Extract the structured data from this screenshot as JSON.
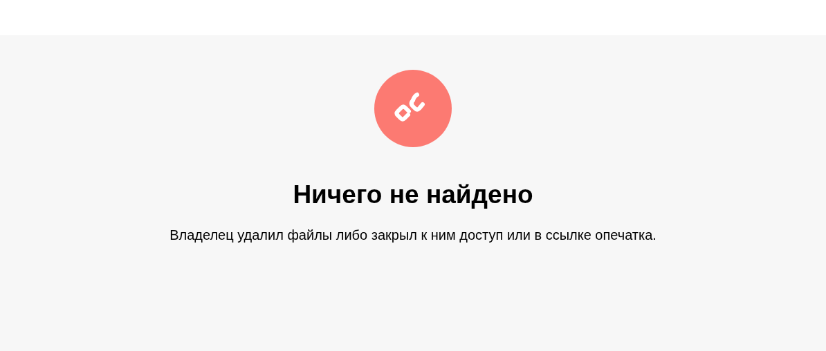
{
  "title": "Ничего не найдено",
  "message": "Владелец удалил файлы либо закрыл к ним доступ или в ссылке опечатка."
}
